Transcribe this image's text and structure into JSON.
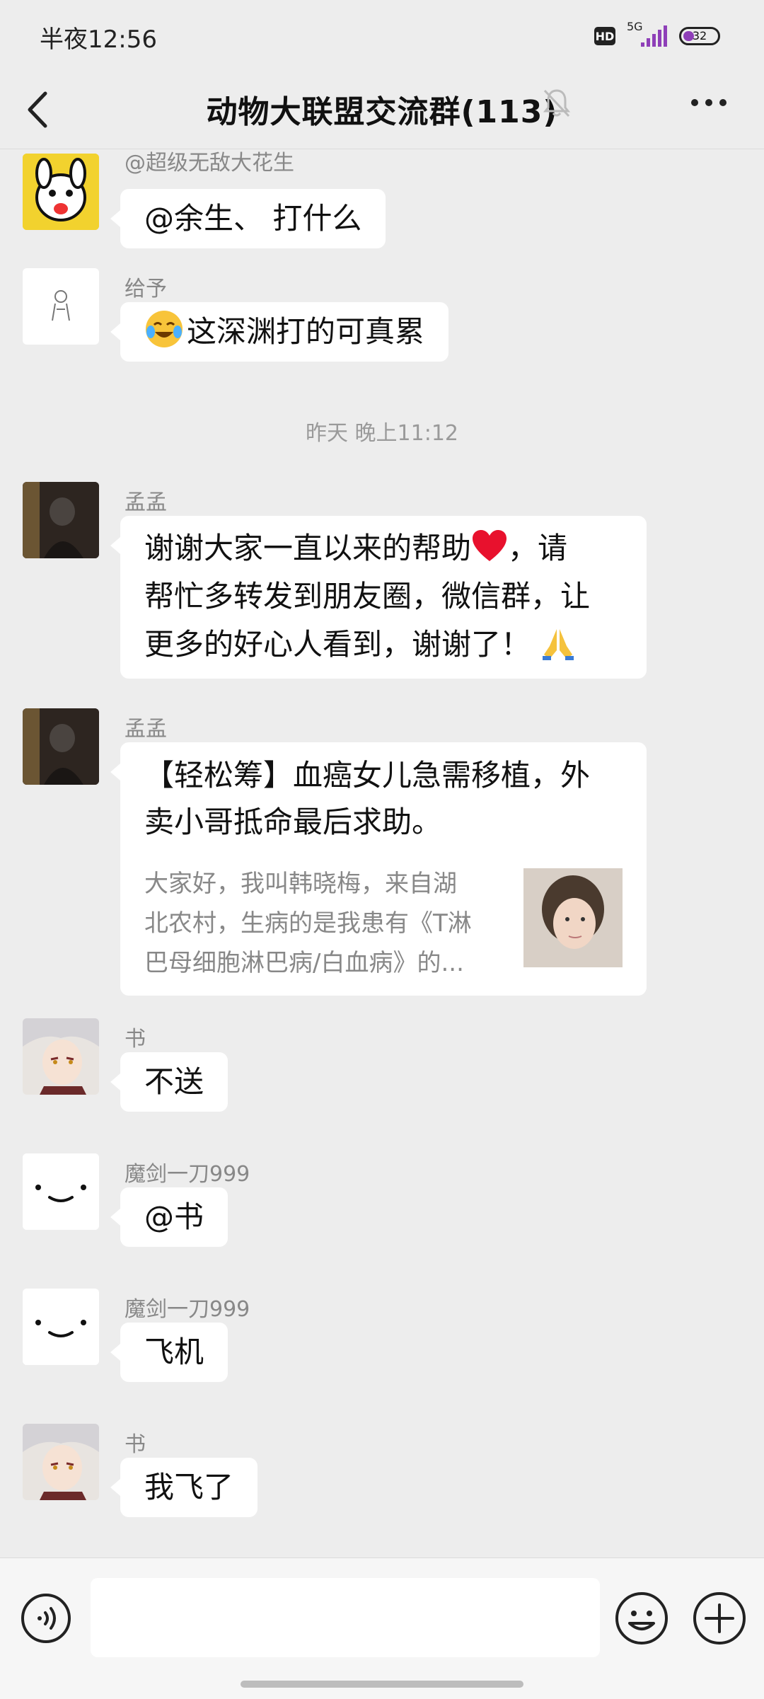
{
  "status_bar": {
    "time": "半夜12:56",
    "hd": "HD",
    "network": "5G",
    "battery": "32",
    "battery_level": 0.32
  },
  "header": {
    "title": "动物大联盟交流群(113)"
  },
  "messages": [
    {
      "sender": "@超级无敌大花生",
      "text": "@余生、  打什么"
    },
    {
      "sender": "给予",
      "emoji": "crying-laughing-emoji",
      "text": "这深渊打的可真累"
    },
    {
      "separator": "昨天 晚上11:12"
    },
    {
      "sender": "孟孟",
      "lines": [
        "谢谢大家一直以来的帮助",
        "，请",
        "帮忙多转发到朋友圈，微信群，让",
        "更多的好心人看到，谢谢了！"
      ],
      "emojis": [
        "red-heart-emoji",
        "folded-hands-emoji"
      ]
    },
    {
      "sender": "孟孟",
      "card_title": [
        "【轻松筹】血癌女儿急需移植，外",
        "卖小哥抵命最后求助。"
      ],
      "card_desc": [
        "大家好，我叫韩晓梅，来自湖",
        "北农村，生病的是我患有《T淋",
        "巴母细胞淋巴病/白血病》的..."
      ]
    },
    {
      "sender": "书",
      "text": "不送"
    },
    {
      "sender": "魔剑一刀999",
      "text": "@书"
    },
    {
      "sender": "魔剑一刀999",
      "text": "飞机"
    },
    {
      "sender": "书",
      "text": "我飞了"
    }
  ],
  "input_bar": {
    "placeholder": ""
  },
  "colors": {
    "background": "#ededed",
    "bubble": "#ffffff",
    "battery_accent": "#8e3fb8"
  }
}
